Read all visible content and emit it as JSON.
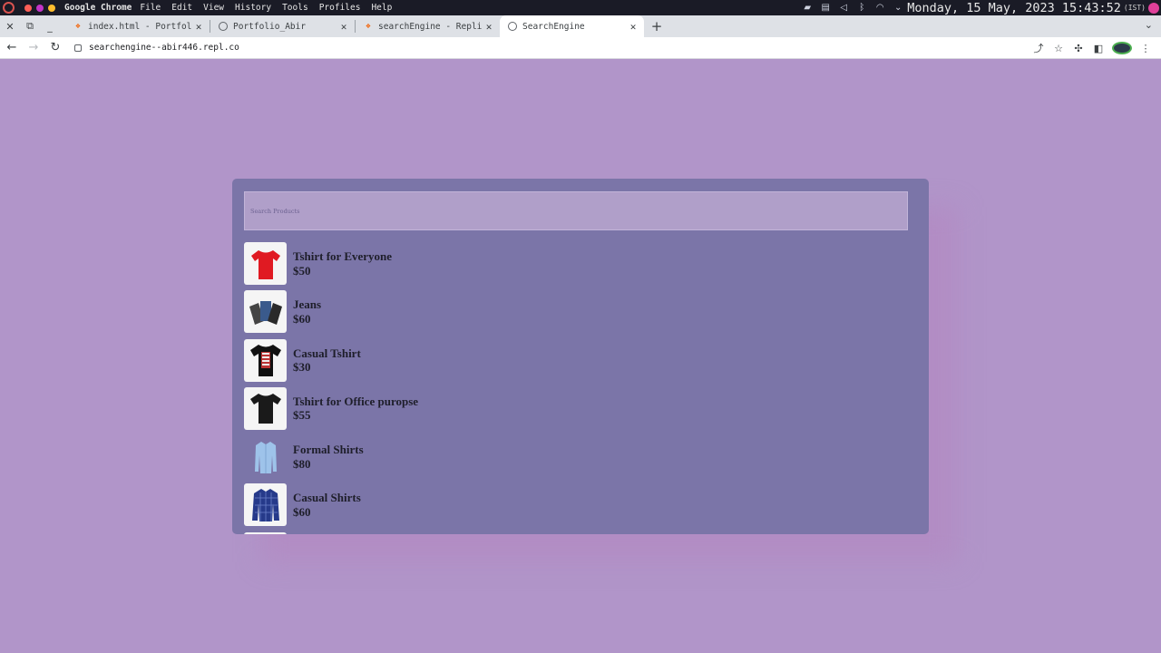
{
  "os": {
    "app_name": "Google Chrome",
    "menu": [
      "File",
      "Edit",
      "View",
      "History",
      "Tools",
      "Profiles",
      "Help"
    ],
    "clock": "Monday, 15 May, 2023 15:43:52",
    "timezone": "(IST)",
    "traffic_colors": [
      "#ff5f57",
      "#c334c9",
      "#ffbd2e"
    ]
  },
  "tabs": [
    {
      "title": "index.html - Portfolio",
      "favicon": "replit-icon"
    },
    {
      "title": "Portfolio_Abir",
      "favicon": "globe-icon"
    },
    {
      "title": "searchEngine - Replit",
      "favicon": "replit-icon"
    },
    {
      "title": "SearchEngine",
      "favicon": "globe-icon",
      "active": true
    }
  ],
  "address": {
    "url": "searchengine--abir446.repl.co"
  },
  "search": {
    "placeholder": "Search Products"
  },
  "products": [
    {
      "name": "Tshirt for Everyone",
      "price": "$50",
      "image": "red-tshirt-icon"
    },
    {
      "name": "Jeans",
      "price": "$60",
      "image": "jeans-icon"
    },
    {
      "name": "Casual Tshirt",
      "price": "$30",
      "image": "black-print-tshirt-icon"
    },
    {
      "name": "Tshirt for Office puropse",
      "price": "$55",
      "image": "black-tshirt-icon"
    },
    {
      "name": "Formal Shirts",
      "price": "$80",
      "image": "blue-formal-shirt-icon"
    },
    {
      "name": "Casual Shirts",
      "price": "$60",
      "image": "checked-shirt-icon"
    }
  ],
  "colors": {
    "page_bg": "#b195c9",
    "card_bg": "#7b75a8",
    "search_bg": "#b09fc9"
  }
}
